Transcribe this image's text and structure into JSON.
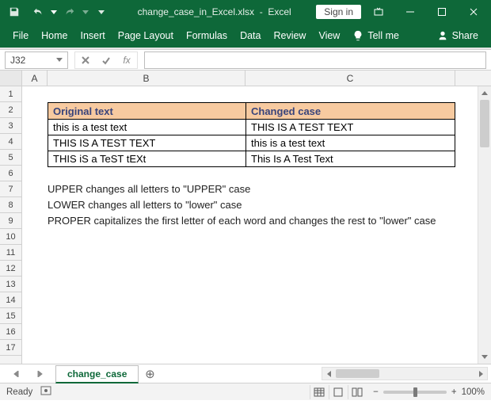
{
  "titlebar": {
    "filename": "change_case_in_Excel.xlsx",
    "app": "Excel",
    "signin": "Sign in"
  },
  "ribbon": {
    "file": "File",
    "home": "Home",
    "insert": "Insert",
    "page_layout": "Page Layout",
    "formulas": "Formulas",
    "data": "Data",
    "review": "Review",
    "view": "View",
    "tell_me": "Tell me",
    "share": "Share"
  },
  "namebox": {
    "ref": "J32"
  },
  "fx": {
    "label": "fx"
  },
  "columns": {
    "a": "A",
    "b": "B",
    "c": "C"
  },
  "rows": [
    "1",
    "2",
    "3",
    "4",
    "5",
    "6",
    "7",
    "8",
    "9",
    "10",
    "11",
    "12",
    "13",
    "14",
    "15",
    "16",
    "17"
  ],
  "table": {
    "header1": "Original text",
    "header2": "Changed case",
    "rows": [
      {
        "c1": "this is a test text",
        "c2": "THIS IS A TEST TEXT"
      },
      {
        "c1": "THIS IS A TEST TEXT",
        "c2": "this is a test text"
      },
      {
        "c1": "THIS iS a TeST tEXt",
        "c2": "This Is A Test Text"
      }
    ]
  },
  "notes": {
    "n1": "UPPER changes all letters to \"UPPER\" case",
    "n2": "LOWER changes all letters to \"lower\" case",
    "n3": "PROPER capitalizes the first letter of each word and changes the rest to  \"lower\" case"
  },
  "sheets": {
    "active": "change_case",
    "add": "+"
  },
  "status": {
    "ready": "Ready",
    "zoom": "100%",
    "minus": "−",
    "plus": "+"
  }
}
